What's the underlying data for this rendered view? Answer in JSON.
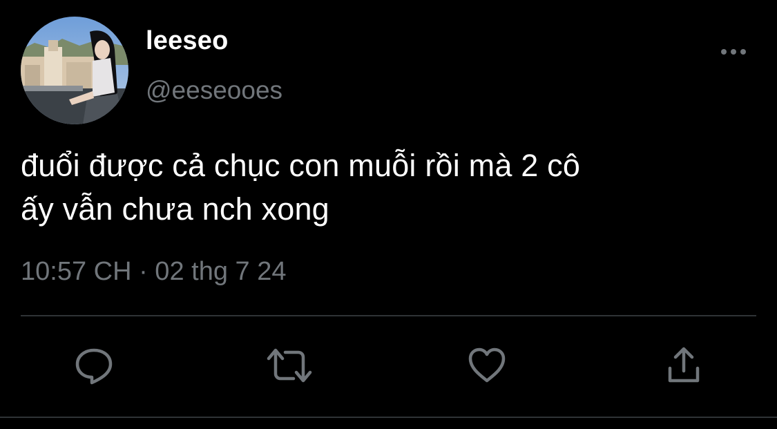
{
  "tweet": {
    "display_name": "leeseo",
    "handle": "@eeseooes",
    "text_line1": "đuổi được cả chục con muỗi rồi mà 2 cô",
    "text_line2": "ấy vẫn chưa nch xong",
    "timestamp": "10:57 CH · 02 thg 7 24"
  },
  "actions": [
    {
      "name": "reply",
      "icon": "speech-bubble-icon"
    },
    {
      "name": "retweet",
      "icon": "retweet-arrows-icon"
    },
    {
      "name": "like",
      "icon": "heart-icon"
    },
    {
      "name": "share",
      "icon": "share-upload-icon"
    }
  ],
  "colors": {
    "background": "#000000",
    "text_primary": "#ffffff",
    "text_secondary": "#71767b",
    "divider": "#2f3336",
    "icon": "#71767b"
  }
}
